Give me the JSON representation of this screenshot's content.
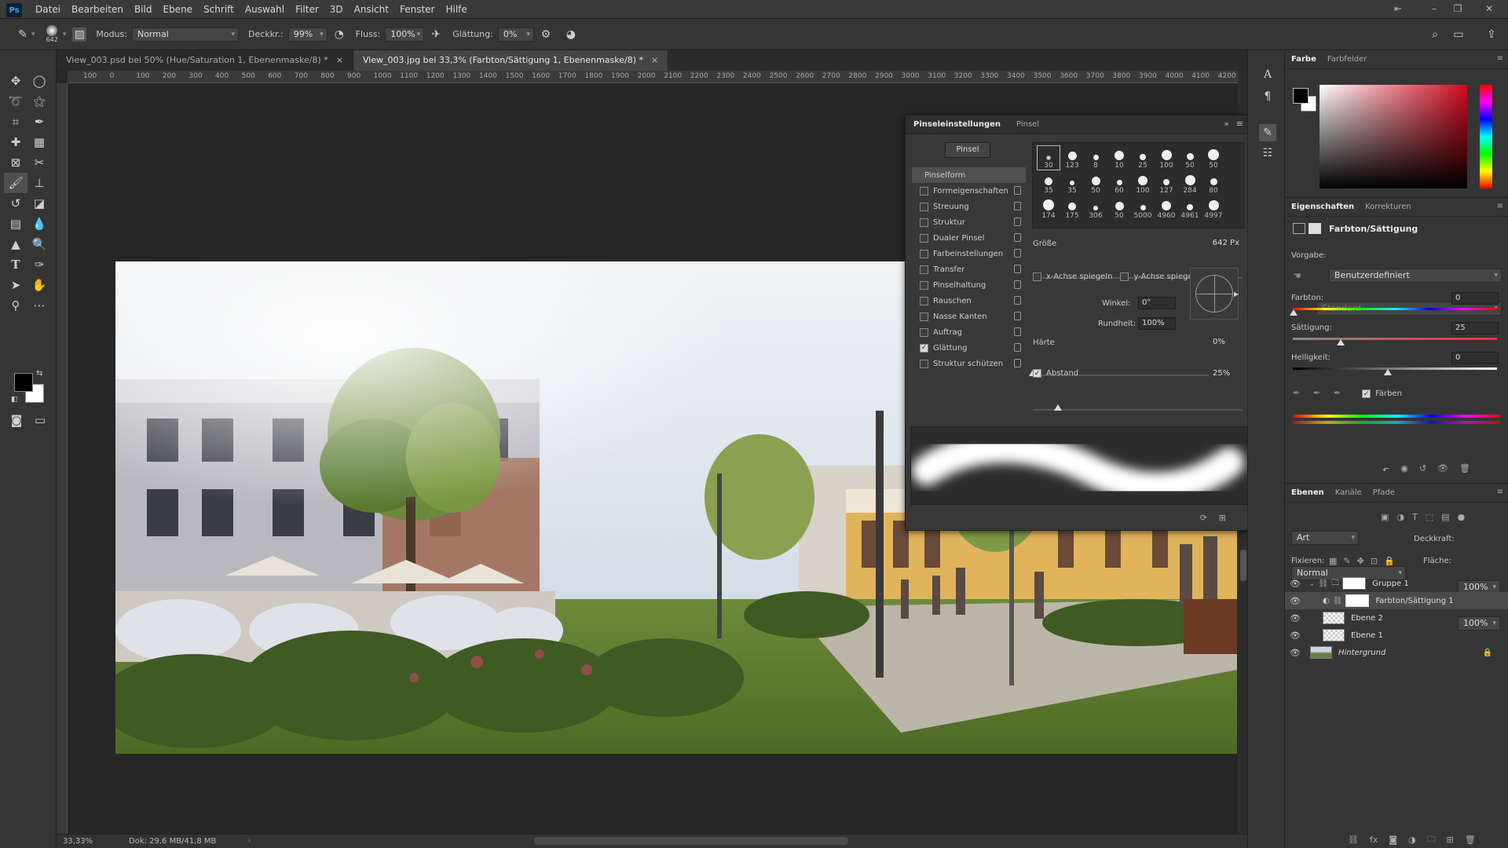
{
  "app": {
    "logo": "Ps"
  },
  "menu": [
    "Datei",
    "Bearbeiten",
    "Bild",
    "Ebene",
    "Schrift",
    "Auswahl",
    "Filter",
    "3D",
    "Ansicht",
    "Fenster",
    "Hilfe"
  ],
  "options": {
    "brush_size": "642",
    "mode_label": "Modus:",
    "mode_value": "Normal",
    "opacity_label": "Deckkr.:",
    "opacity_value": "99%",
    "flow_label": "Fluss:",
    "flow_value": "100%",
    "smoothing_label": "Glättung:",
    "smoothing_value": "0%"
  },
  "tabs": [
    {
      "label": "View_003.psd bei 50% (Hue/Saturation 1, Ebenenmaske/8) *",
      "close": "×"
    },
    {
      "label": "View_003.jpg bei 33,3% (Farbton/Sättigung 1, Ebenenmaske/8) *",
      "close": "×"
    }
  ],
  "ruler_ticks": [
    "100",
    "0",
    "100",
    "200",
    "300",
    "400",
    "500",
    "600",
    "700",
    "800",
    "900",
    "1000",
    "1100",
    "1200",
    "1300",
    "1400",
    "1500",
    "1600",
    "1700",
    "1800",
    "1900",
    "2000",
    "2100",
    "2200",
    "2300",
    "2400",
    "2500",
    "2600",
    "2700",
    "2800",
    "2900",
    "3000",
    "3100",
    "3200",
    "3300",
    "3400",
    "3500",
    "3600",
    "3700",
    "3800",
    "3900",
    "4000",
    "4100",
    "4200"
  ],
  "status": {
    "zoom": "33,33%",
    "doc": "Dok: 29,6 MB/41,8 MB"
  },
  "brush_panel": {
    "tab_active": "Pinseleinstellungen",
    "tab_other": "Pinsel",
    "brush_button": "Pinsel",
    "section_header": "Pinselform",
    "items": [
      {
        "label": "Formeigenschaften",
        "checked": false
      },
      {
        "label": "Streuung",
        "checked": false
      },
      {
        "label": "Struktur",
        "checked": false
      },
      {
        "label": "Dualer Pinsel",
        "checked": false
      },
      {
        "label": "Farbeinstellungen",
        "checked": false
      },
      {
        "label": "Transfer",
        "checked": false
      },
      {
        "label": "Pinselhaltung",
        "checked": false
      },
      {
        "label": "Rauschen",
        "checked": false
      },
      {
        "label": "Nasse Kanten",
        "checked": false
      },
      {
        "label": "Auftrag",
        "checked": false
      },
      {
        "label": "Glättung",
        "checked": true
      },
      {
        "label": "Struktur schützen",
        "checked": false
      }
    ],
    "tips": [
      [
        "30",
        "123",
        "8",
        "10",
        "25",
        "100",
        "50",
        "50"
      ],
      [
        "35",
        "35",
        "50",
        "60",
        "100",
        "127",
        "284",
        "80"
      ],
      [
        "174",
        "175",
        "306",
        "50",
        "5000",
        "4960",
        "4961",
        "4997"
      ]
    ],
    "size_label": "Größe",
    "size_value": "642 Px",
    "size_level": 0.86,
    "flip_x": "x-Achse spiegeln",
    "flip_y": "y-Achse spiegeln",
    "angle_label": "Winkel:",
    "angle_value": "0°",
    "roundness_label": "Rundheit:",
    "roundness_value": "100%",
    "hardness_label": "Härte",
    "hardness_value": "0%",
    "hardness_level": 0.0,
    "spacing_label": "Abstand",
    "spacing_value": "25%",
    "spacing_level": 0.12
  },
  "color_panel": {
    "tab_active": "Farbe",
    "tab_other": "Farbfelder"
  },
  "properties": {
    "tab_active": "Eigenschaften",
    "tab_other": "Korrekturen",
    "title": "Farbton/Sättigung",
    "preset_label": "Vorgabe:",
    "preset_value": "Benutzerdefiniert",
    "channel_value": "Standard",
    "hue_label": "Farbton:",
    "hue_value": "0",
    "sat_label": "Sättigung:",
    "sat_value": "25",
    "light_label": "Helligkeit:",
    "light_value": "0",
    "colorize_label": "Färben"
  },
  "layers": {
    "tab_active": "Ebenen",
    "tab_channels": "Kanäle",
    "tab_paths": "Pfade",
    "filter_value": "Art",
    "blend_value": "Normal",
    "opacity_label": "Deckkraft:",
    "opacity_value": "100%",
    "lock_label": "Fixieren:",
    "fill_label": "Fläche:",
    "fill_value": "100%",
    "items": [
      {
        "name": "Gruppe 1"
      },
      {
        "name": "Farbton/Sättigung 1"
      },
      {
        "name": "Ebene 2"
      },
      {
        "name": "Ebene 1"
      },
      {
        "name": "Hintergrund"
      }
    ]
  }
}
